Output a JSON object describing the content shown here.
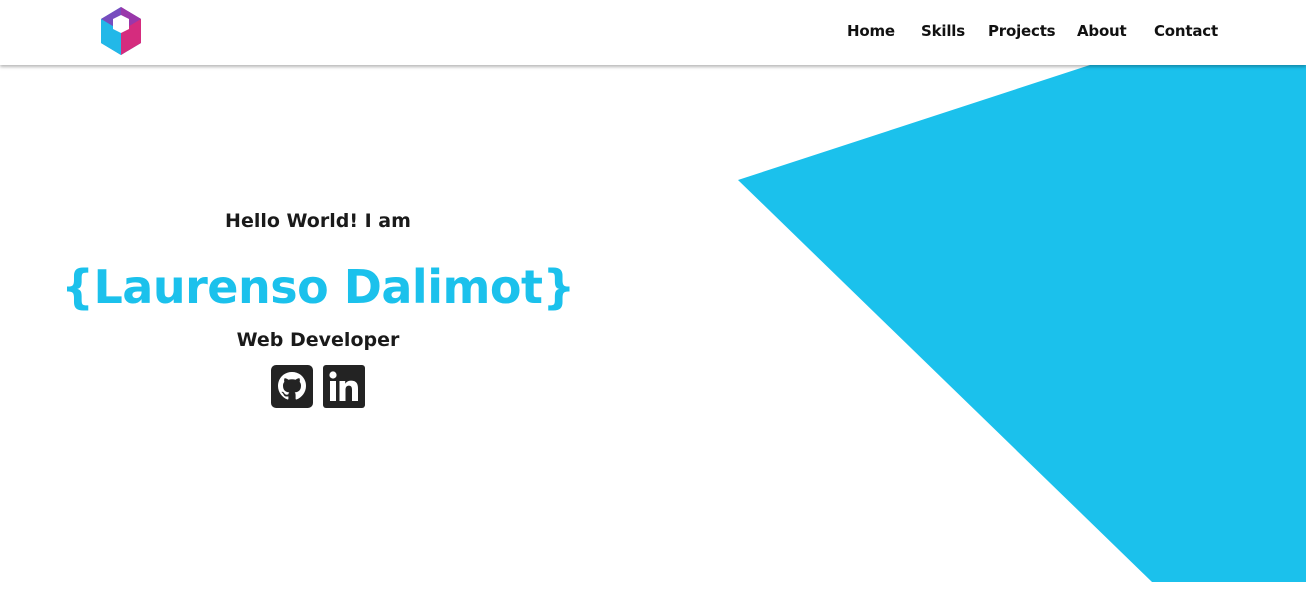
{
  "theme": {
    "accent_color": "#1bc1ec",
    "text_color": "#1a1a1a",
    "icon_color": "#232323"
  },
  "header": {
    "logo_icon": "hexagon-logo-icon",
    "nav": [
      {
        "label": "Home"
      },
      {
        "label": "Skills"
      },
      {
        "label": "Projects"
      },
      {
        "label": "About"
      },
      {
        "label": "Contact"
      }
    ]
  },
  "hero": {
    "greeting": "Hello World! I am",
    "name": "{Laurenso Dalimot}",
    "role": "Web Developer",
    "social": [
      {
        "icon": "github-icon"
      },
      {
        "icon": "linkedin-icon"
      }
    ]
  }
}
